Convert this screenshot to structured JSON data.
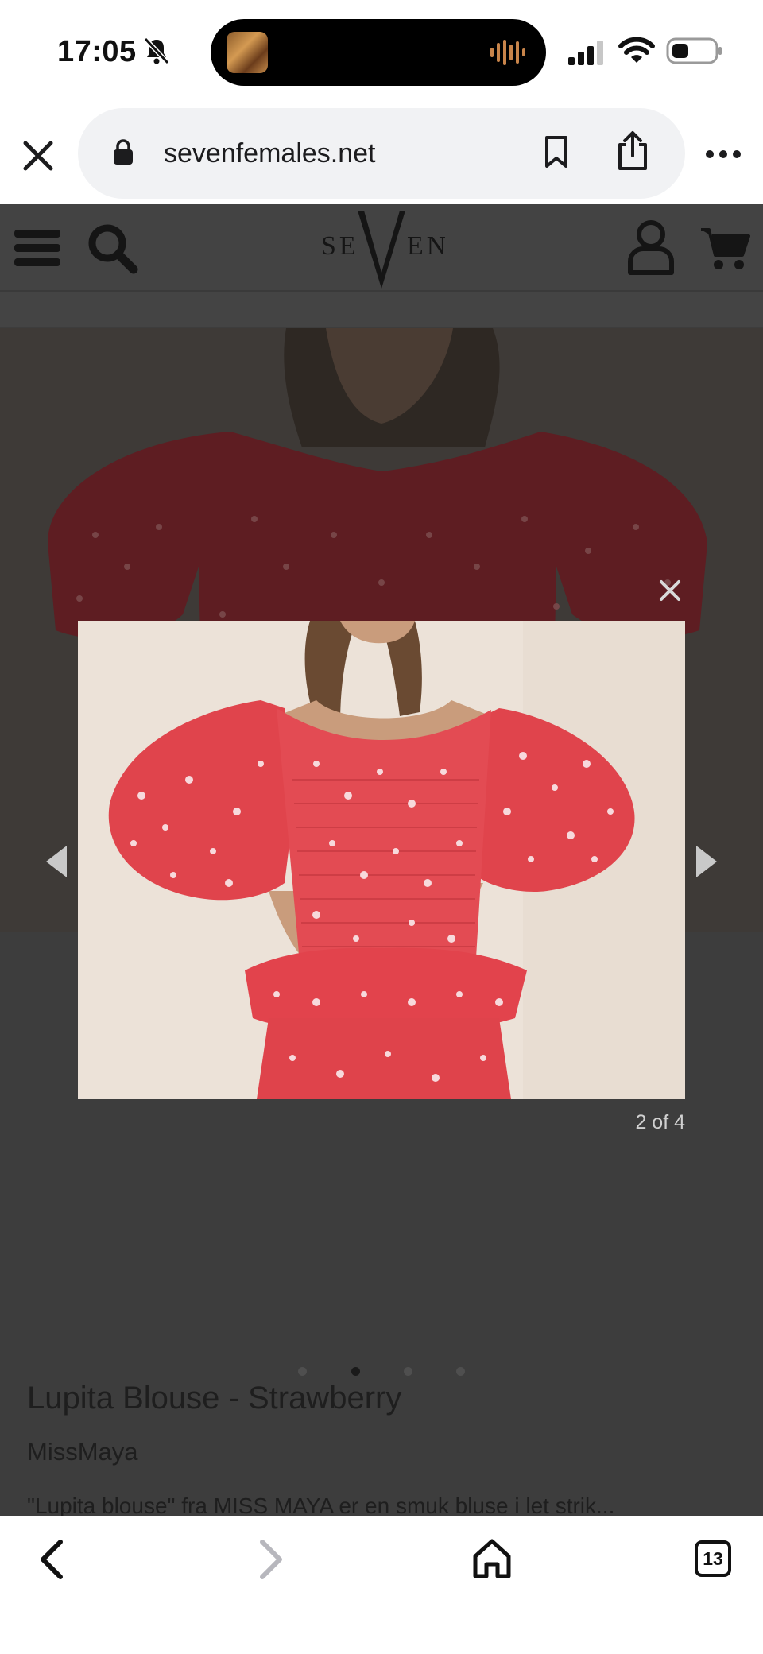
{
  "status_bar": {
    "time": "17:05",
    "icons": [
      "bell-slash-icon",
      "signal-icon",
      "wifi-icon",
      "battery-icon"
    ]
  },
  "browser": {
    "url": "sevenfemales.net",
    "tab_count": "13"
  },
  "site": {
    "logo_text": "SEVEN",
    "product_title": "Lupita Blouse - Strawberry",
    "product_brand": "MissMaya",
    "product_description": "\"Lupita blouse\" fra MISS MAYA er en smuk bluse i let strik..."
  },
  "lightbox": {
    "counter": "2 of 4",
    "close_symbol": "×",
    "image_subject": "red floral off-shoulder puff-sleeve blouse"
  },
  "carousel": {
    "total": 4,
    "active_index": 1
  },
  "colors": {
    "overlay": "#3d3d3d",
    "blouse_red": "#e0444c",
    "backdrop": "#ece2d8"
  }
}
